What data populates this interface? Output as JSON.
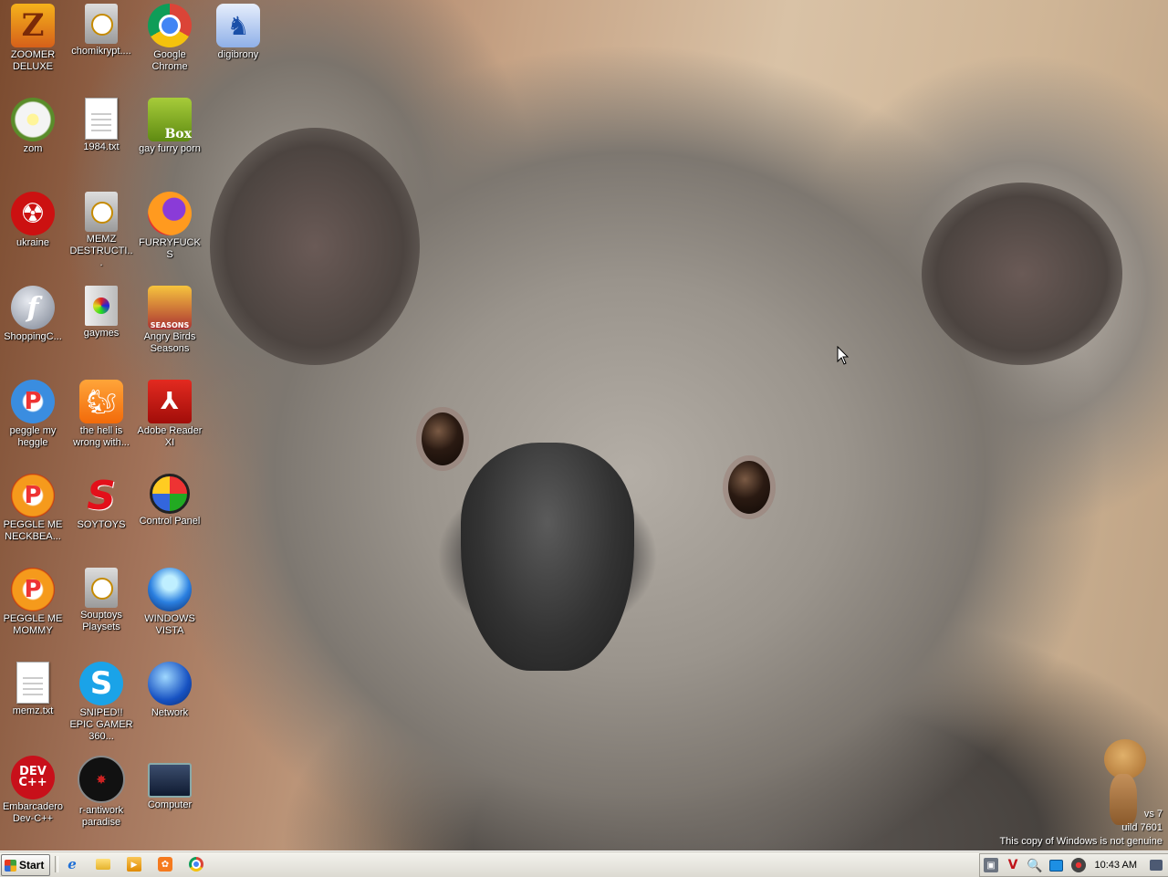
{
  "desktop": {
    "icons": [
      {
        "label": "ZOOMER DELUXE",
        "icon": "zoomer-game-icon",
        "glyph": "Z"
      },
      {
        "label": "chomikrypt....",
        "icon": "executable-icon",
        "glyph": ""
      },
      {
        "label": "Google Chrome",
        "icon": "chrome-icon",
        "glyph": ""
      },
      {
        "label": "digibrony",
        "icon": "blue-app-icon",
        "glyph": "♞"
      },
      {
        "label": "zom",
        "icon": "flower-icon",
        "glyph": ""
      },
      {
        "label": "1984.txt",
        "icon": "text-file-icon",
        "glyph": ""
      },
      {
        "label": "gay furry porn",
        "icon": "box-game-icon",
        "glyph": "Box"
      },
      {
        "label": "ukraine",
        "icon": "radiation-icon",
        "glyph": "☢"
      },
      {
        "label": "MEMZ DESTRUCTI...",
        "icon": "executable-icon",
        "glyph": ""
      },
      {
        "label": "FURRYFUCKS",
        "icon": "firefox-icon",
        "glyph": ""
      },
      {
        "label": "ShoppingC...",
        "icon": "flash-icon",
        "glyph": "f"
      },
      {
        "label": "gaymes",
        "icon": "games-folder-icon",
        "glyph": ""
      },
      {
        "label": "Angry Birds Seasons",
        "icon": "angry-birds-icon",
        "glyph": "SEASONS"
      },
      {
        "label": "peggle my heggle",
        "icon": "peggle-icon",
        "glyph": "P"
      },
      {
        "label": "the hell is wrong with...",
        "icon": "uc-browser-icon",
        "glyph": "🐿"
      },
      {
        "label": "Adobe Reader XI",
        "icon": "adobe-reader-icon",
        "glyph": "⅄"
      },
      {
        "label": "PEGGLE ME NECKBEA...",
        "icon": "peggle-orange-icon",
        "glyph": "P"
      },
      {
        "label": "SOYTOYS",
        "icon": "soytoys-icon",
        "glyph": "S"
      },
      {
        "label": "Control Panel",
        "icon": "control-panel-icon",
        "glyph": ""
      },
      {
        "label": "PEGGLE ME MOMMY",
        "icon": "peggle-orange-icon",
        "glyph": "P"
      },
      {
        "label": "Souptoys Playsets",
        "icon": "executable-icon",
        "glyph": ""
      },
      {
        "label": "WINDOWS VISTA",
        "icon": "vista-orb-icon",
        "glyph": ""
      },
      {
        "label": "memz.txt",
        "icon": "text-file-icon",
        "glyph": ""
      },
      {
        "label": "SNIPED!! EPIC GAMER 360...",
        "icon": "skype-icon",
        "glyph": "S"
      },
      {
        "label": "Network",
        "icon": "network-globe-icon",
        "glyph": ""
      },
      {
        "label": "Embarcadero Dev-C++",
        "icon": "devcpp-icon",
        "glyph": "DEV C++"
      },
      {
        "label": "r-antiwork paradise",
        "icon": "antiwork-icon",
        "glyph": "✸"
      },
      {
        "label": "Computer",
        "icon": "computer-icon",
        "glyph": ""
      }
    ]
  },
  "watermark": {
    "line1": "vs 7",
    "line2": "uild 7601",
    "line3": "This copy of Windows is not genuine"
  },
  "taskbar": {
    "start_label": "Start",
    "quick_launch": [
      {
        "icon": "internet-explorer-icon",
        "glyph": "e"
      },
      {
        "icon": "folder-icon",
        "glyph": ""
      },
      {
        "icon": "media-player-icon",
        "glyph": "▶"
      },
      {
        "icon": "uc-browser-icon",
        "glyph": "✿"
      },
      {
        "icon": "chrome-icon",
        "glyph": ""
      }
    ],
    "tray_icons": [
      {
        "icon": "tray-app-icon",
        "glyph": "▣"
      },
      {
        "icon": "vivaldi-icon",
        "glyph": "V"
      },
      {
        "icon": "search-icon",
        "glyph": "🔍"
      },
      {
        "icon": "network-status-icon",
        "glyph": ""
      },
      {
        "icon": "media-icon",
        "glyph": ""
      }
    ],
    "clock": "10:43 AM",
    "show_desktop_icon": "show-desktop-icon"
  }
}
